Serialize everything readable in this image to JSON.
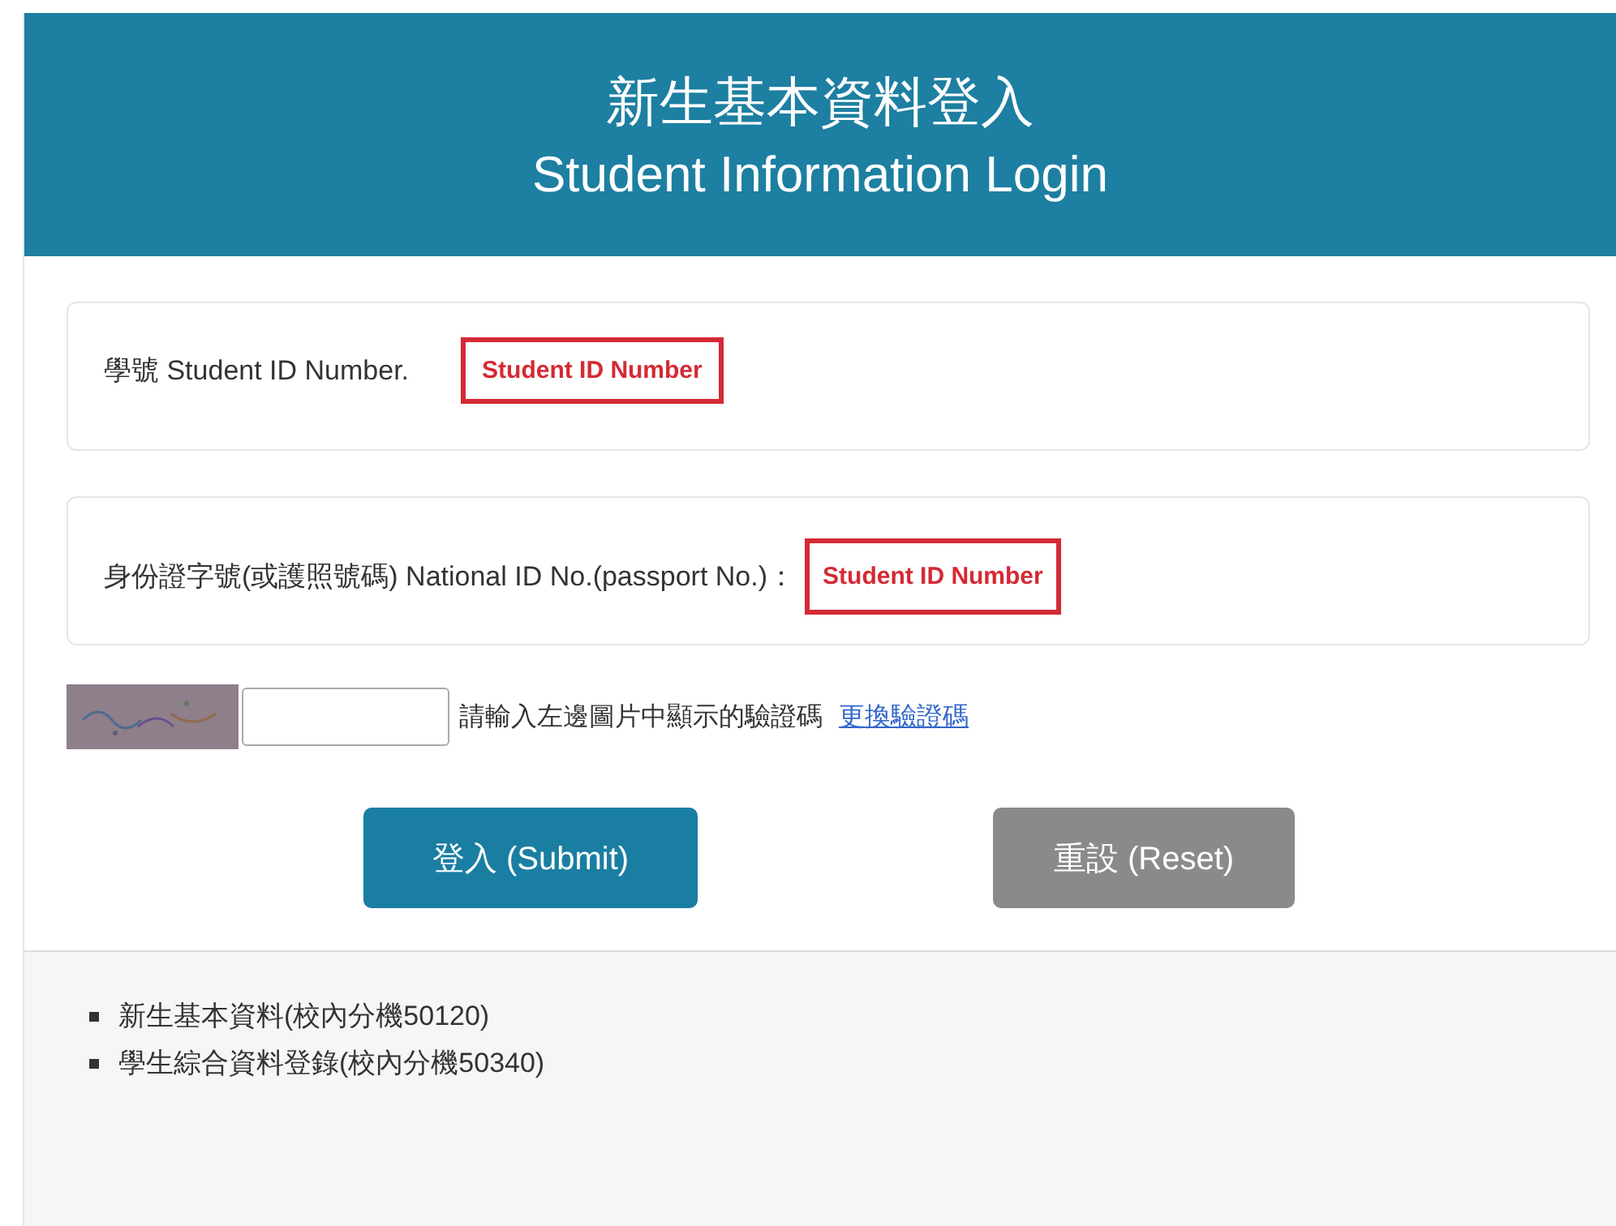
{
  "header": {
    "title_zh": "新生基本資料登入",
    "title_en": "Student Information Login"
  },
  "fields": [
    {
      "label": "學號 Student ID Number.",
      "annotation": "Student ID Number"
    },
    {
      "label": "身份證字號(或護照號碼) National ID No.(passport No.)：",
      "annotation": "Student ID Number"
    }
  ],
  "captcha": {
    "kind": "picture",
    "hint": "請輸入左邊圖片中顯示的驗證碼",
    "link": "更換驗證碼"
  },
  "buttons": [
    {
      "label": "登入 (Submit)",
      "kind": "primary"
    },
    {
      "label": "重設 (Reset)",
      "kind": "secondary"
    }
  ],
  "footer": {
    "items": [
      "新生基本資料(校內分機50120)",
      "學生綜合資料登錄(校內分機50340)"
    ]
  }
}
